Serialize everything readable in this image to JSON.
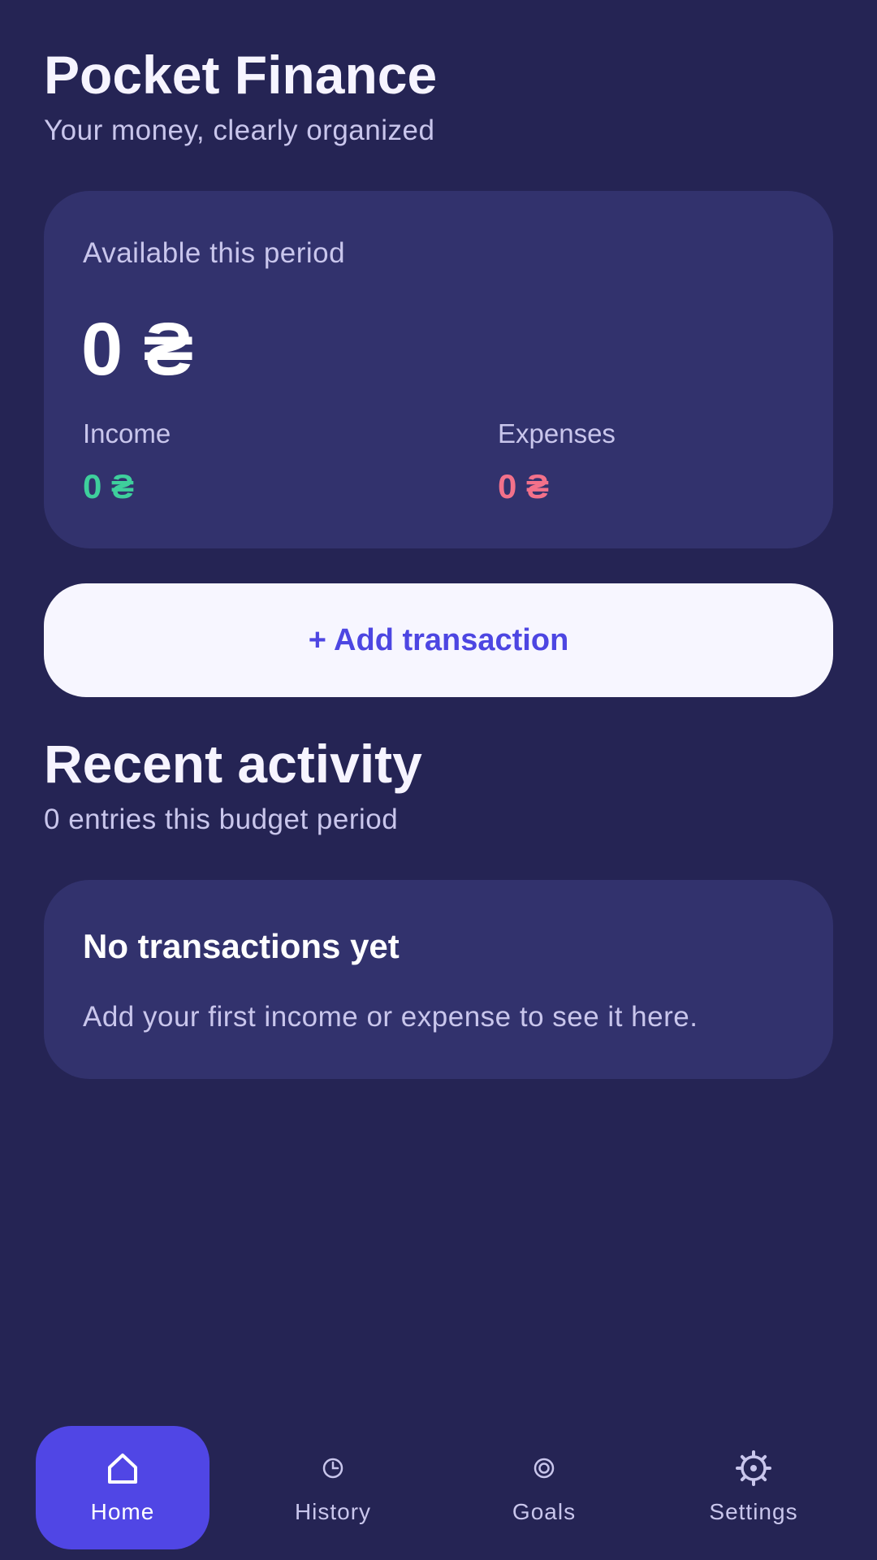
{
  "header": {
    "title": "Pocket Finance",
    "subtitle": "Your money, clearly organized"
  },
  "balance": {
    "label": "Available this period",
    "amount": "0 ₴",
    "income_label": "Income",
    "income_value": "0 ₴",
    "expenses_label": "Expenses",
    "expenses_value": "0 ₴"
  },
  "actions": {
    "add_transaction_label": "+ Add transaction"
  },
  "recent": {
    "title": "Recent activity",
    "subtitle": "0 entries this budget period",
    "empty_title": "No transactions yet",
    "empty_text": "Add your first income or expense to see it here."
  },
  "nav": {
    "items": [
      {
        "label": "Home",
        "icon": "home-icon",
        "active": true
      },
      {
        "label": "History",
        "icon": "clock-icon",
        "active": false
      },
      {
        "label": "Goals",
        "icon": "target-icon",
        "active": false
      },
      {
        "label": "Settings",
        "icon": "gear-icon",
        "active": false
      }
    ]
  },
  "colors": {
    "background": "#252454",
    "card": "#32326d",
    "accent": "#5046e5",
    "income": "#3ecf9c",
    "expense": "#f3718a"
  }
}
